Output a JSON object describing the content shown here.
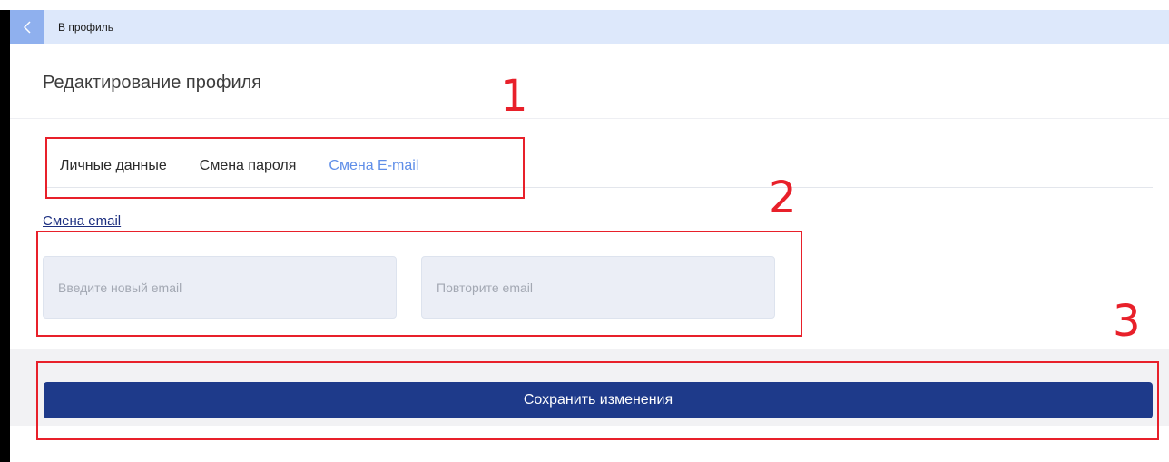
{
  "topbar": {
    "back_label": "В профиль"
  },
  "page": {
    "title": "Редактирование профиля"
  },
  "tabs": [
    {
      "label": "Личные данные",
      "active": false
    },
    {
      "label": "Смена пароля",
      "active": false
    },
    {
      "label": "Смена E-mail",
      "active": true
    }
  ],
  "section": {
    "title": "Смена email"
  },
  "fields": {
    "new_email": {
      "placeholder": "Введите новый email",
      "value": ""
    },
    "repeat_email": {
      "placeholder": "Повторите email",
      "value": ""
    }
  },
  "actions": {
    "save_label": "Сохранить изменения"
  },
  "annotations": [
    "1",
    "2",
    "3"
  ],
  "colors": {
    "topbar_bg": "#dde8fb",
    "back_button_bg": "#8fb0ee",
    "active_tab": "#5f8ee8",
    "primary_button": "#1e3a8a",
    "section_link": "#1c2f80",
    "annotation_red": "#e8202a"
  }
}
